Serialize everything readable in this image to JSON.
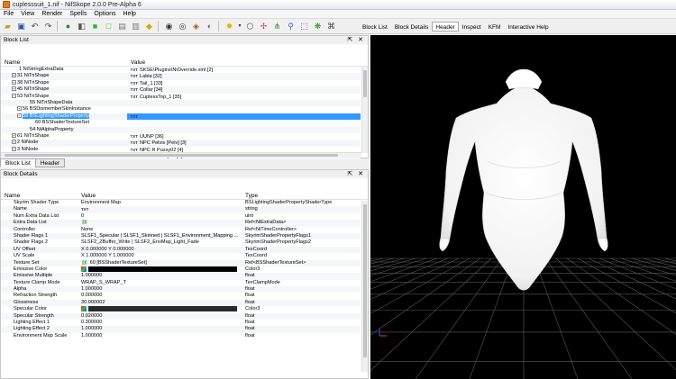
{
  "window": {
    "title": "cuplesssuit_1.nif - NifSkope 2.0.0 Pre-Alpha 6"
  },
  "menu": [
    "File",
    "View",
    "Render",
    "Spells",
    "Options",
    "Help"
  ],
  "toolbar": {
    "icons": [
      "open-icon",
      "save-icon",
      "undo-icon",
      "redo-icon",
      "globe-icon",
      "select-icon",
      "cube-icon",
      "cube-outline-icon",
      "box-icon",
      "box2-icon",
      "cube-yellow-icon",
      "eye-icon",
      "texture-eye-icon",
      "vertex-eye-icon",
      "lighting-icon",
      "lightbulb-icon",
      "wireframe-icon",
      "axes-icon",
      "nodes-icon",
      "skeleton-icon",
      "frame-icon",
      "particles-icon",
      "camera-icon"
    ],
    "tabs": [
      "Block List",
      "Block Details",
      "Header",
      "Inspect",
      "KFM",
      "Interactive Help"
    ],
    "active_tab": "Header"
  },
  "block_list": {
    "title": "Block List",
    "columns": [
      "Name",
      "Value"
    ],
    "rows": [
      {
        "indent": 2,
        "exp": "",
        "name": "1 NiStringExtraData",
        "txt": true,
        "value": "SKSE\\Plugins\\NiOverride.xml [2]"
      },
      {
        "indent": 2,
        "exp": "+",
        "name": "31 NiTriShape",
        "txt": true,
        "value": "Labia [32]"
      },
      {
        "indent": 2,
        "exp": "+",
        "name": "38 NiTriShape",
        "txt": true,
        "value": "Tail_1 [33]"
      },
      {
        "indent": 2,
        "exp": "+",
        "name": "45 NiTriShape",
        "txt": true,
        "value": "Collar [34]"
      },
      {
        "indent": 2,
        "exp": "−",
        "name": "53 NiTriShape",
        "txt": true,
        "value": "CuplessTop_1 [35]"
      },
      {
        "indent": 4,
        "exp": "",
        "name": "55 NiTriShapeData",
        "txt": false,
        "value": ""
      },
      {
        "indent": 3,
        "exp": "+",
        "name": "56 BSDismemberSkinInstance",
        "txt": false,
        "value": ""
      },
      {
        "indent": 3,
        "exp": "−",
        "name": "59 BSLightingShaderProperty",
        "txt": true,
        "value": "",
        "selected": true
      },
      {
        "indent": 5,
        "exp": "",
        "name": "60 BSShaderTextureSet",
        "txt": false,
        "value": ""
      },
      {
        "indent": 4,
        "exp": "",
        "name": "54 NiAlphaProperty",
        "txt": false,
        "value": ""
      },
      {
        "indent": 2,
        "exp": "+",
        "name": "61 NiTriShape",
        "txt": true,
        "value": "UUNP [36]"
      },
      {
        "indent": 2,
        "exp": "+",
        "name": "2 NiNode",
        "txt": true,
        "value": "NPC Pelvis [Pelv] [3]"
      },
      {
        "indent": 2,
        "exp": "+",
        "name": "3 NiNode",
        "txt": true,
        "value": "NPC R Pussy02 [4]"
      },
      {
        "indent": 2,
        "exp": "+",
        "name": "4 NiNode",
        "txt": true,
        "value": "NPC L Pussy02 [5]"
      }
    ]
  },
  "bottom_tabs": [
    "Block List",
    "Header"
  ],
  "block_details": {
    "title": "Block Details",
    "columns": [
      "Name",
      "Value",
      "Type"
    ],
    "rows": [
      {
        "name": "Skyrim Shader Type",
        "value": "Environment Map",
        "type": "BSLightingShaderPropertyShaderType"
      },
      {
        "name": "Name",
        "value": "",
        "txt": true,
        "type": "string"
      },
      {
        "name": "Num Extra Data List",
        "value": "0",
        "type": "uint"
      },
      {
        "name": "Extra Data List",
        "value": "",
        "icon": "link-icon",
        "type": "Ref<NiExtraData>"
      },
      {
        "name": "Controller",
        "value": "None",
        "type": "Ref<NiTimeController>"
      },
      {
        "name": "Shader Flags 1",
        "value": "SLSF1_Specular | SLSF1_Skinned | SLSF1_Environment_Mapping ...",
        "type": "SkyrimShaderPropertyFlags1"
      },
      {
        "name": "Shader Flags 2",
        "value": "SLSF2_ZBuffer_Write | SLSF2_EnvMap_Light_Fade",
        "type": "SkyrimShaderPropertyFlags2"
      },
      {
        "name": "UV Offset",
        "value": "X 0.000000 Y 0.000000",
        "type": "TexCoord"
      },
      {
        "name": "UV Scale",
        "value": "X 1.000000 Y 1.000000",
        "type": "TexCoord"
      },
      {
        "name": "Texture Set",
        "value": "60 [BSShaderTextureSet]",
        "icon": "link-icon",
        "type": "Ref<BSShaderTextureSet>"
      },
      {
        "name": "Emissive Color",
        "value": "",
        "swatch": "#000000",
        "type": "Color3"
      },
      {
        "name": "Emissive Multiple",
        "value": "1.000000",
        "type": "float"
      },
      {
        "name": "Texture Clamp Mode",
        "value": "WRAP_S_WRAP_T",
        "type": "TexClampMode"
      },
      {
        "name": "Alpha",
        "value": "1.000000",
        "type": "float"
      },
      {
        "name": "Refraction Strength",
        "value": "0.000000",
        "type": "float"
      },
      {
        "name": "Glossiness",
        "value": "30.000002",
        "type": "float"
      },
      {
        "name": "Specular Color",
        "value": "",
        "swatch": "#2a2a2a",
        "type": "Color3"
      },
      {
        "name": "Specular Strength",
        "value": "0.920000",
        "type": "float"
      },
      {
        "name": "Lighting Effect 1",
        "value": "0.300000",
        "type": "float"
      },
      {
        "name": "Lighting Effect 2",
        "value": "1.000000",
        "type": "float"
      },
      {
        "name": "Environment Map Scale",
        "value": "1.000000",
        "type": "float"
      }
    ]
  },
  "colors": {
    "selection": "#3399ff",
    "viewport_bg": "#000000",
    "grid": "#5a5a5a"
  }
}
